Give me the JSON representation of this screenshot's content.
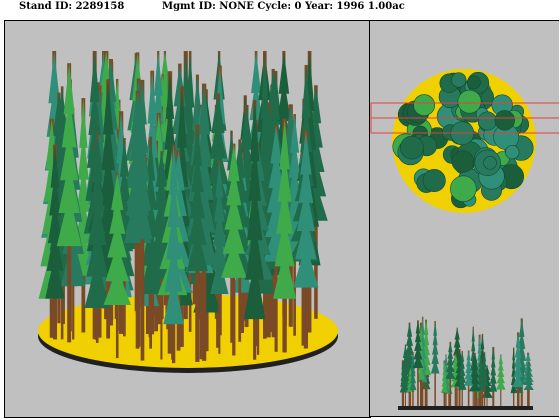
{
  "header": {
    "stand_label": "Stand ID: 2289158",
    "mgmt_label": "Mgmt ID: NONE Cycle: 0 Year: 1996 1.00ac"
  },
  "views": {
    "perspective": {
      "name": "perspective-view"
    },
    "plan": {
      "name": "plan-view"
    },
    "profile": {
      "name": "profile-view"
    }
  },
  "colors": {
    "background": "#c0c0c0",
    "ground": "#f0d000",
    "ground_edge": "#202020",
    "conifer_dark": "#1f6b4a",
    "conifer_teal": "#2f8f78",
    "conifer_light": "#3faa4a",
    "trunk": "#7a4a26",
    "selection_box": "#e04040"
  }
}
